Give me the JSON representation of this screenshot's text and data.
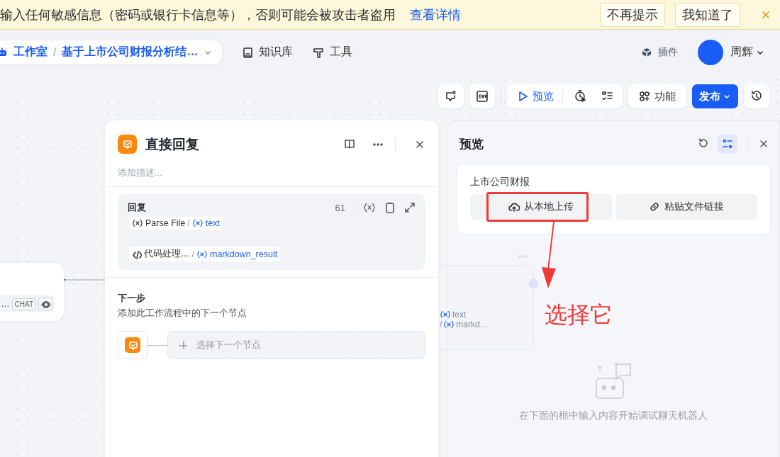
{
  "banner": {
    "message": "输入任何敏感信息（密码或银行卡信息等），否则可能会被攻击者盗用",
    "link": "查看详情",
    "buttons": [
      "不再提示",
      "我知道了"
    ]
  },
  "header": {
    "breadcrumb": [
      "工作室",
      "基于上市公司财报分析结…"
    ],
    "breadcrumb_separator": "/",
    "nav": [
      {
        "label": "知识库",
        "kind": "book"
      },
      {
        "label": "工具",
        "kind": "tool"
      }
    ],
    "plugin": "插件",
    "user": "周辉"
  },
  "toolbar": {
    "preview": "预览",
    "features": "功能",
    "publish": "发布"
  },
  "canvas": {
    "side_node": {
      "text": "…",
      "tag": "CHAT"
    },
    "ghost_node": {
      "lines": [
        {
          "text": "text"
        },
        {
          "separator": "/",
          "text": "markd…"
        }
      ]
    }
  },
  "node_panel": {
    "title": "直接回复",
    "description_placeholder": "添加描述...",
    "reply": {
      "label": "回复",
      "count": "61",
      "tokens": [
        {
          "kind": "variable",
          "source": "Parse File",
          "separator": "/",
          "field": "text"
        },
        {
          "kind": "code",
          "source": "代码处理…",
          "separator": "/",
          "field": "markdown_result"
        }
      ]
    },
    "next_step": {
      "title": "下一步",
      "description": "添加此工作流程中的下一个节点",
      "add_label": "选择下一个节点"
    }
  },
  "preview_panel": {
    "title": "预览",
    "input": {
      "label": "上市公司财报",
      "buttons": [
        {
          "kind": "upload",
          "label": "从本地上传"
        },
        {
          "kind": "link",
          "label": "粘贴文件链接"
        }
      ]
    },
    "empty_text": "在下面的框中输入内容开始调试聊天机器人"
  },
  "annotation": {
    "text": "选择它"
  }
}
